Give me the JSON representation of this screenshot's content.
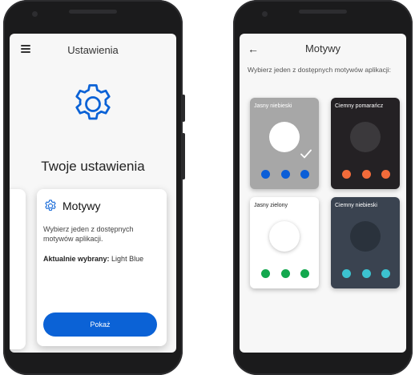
{
  "colors": {
    "primary_blue": "#0b62d6",
    "phone_body": "#1b1b1c",
    "screen_bg": "#f7f7f7"
  },
  "left_screen": {
    "menu_icon": "hamburger-menu-icon",
    "title": "Ustawienia",
    "hero_icon": "gear-icon",
    "heading": "Twoje ustawienia",
    "card": {
      "icon": "gear-icon",
      "title": "Motywy",
      "description": "Wybierz jeden z dostępnych motywów aplikacji.",
      "current_label": "Aktualnie wybrany:",
      "current_value": "Light Blue",
      "button_label": "Pokaż"
    }
  },
  "right_screen": {
    "back_icon": "arrow-left-icon",
    "title": "Motywy",
    "description": "Wybierz jeden z dostępnych motywów aplikacji:",
    "themes": [
      {
        "name": "Jasny niebieski",
        "selected": true,
        "bg": "#a7a7a7",
        "circle": "#ffffff",
        "label_color": "#ffffff",
        "dot_color": "#0b5ed7"
      },
      {
        "name": "Ciemny pomarańcz",
        "selected": false,
        "bg": "#242124",
        "circle": "#3b393c",
        "label_color": "#ffffff",
        "dot_color": "#f26b3a"
      },
      {
        "name": "Jasny zielony",
        "selected": false,
        "bg": "#ffffff",
        "circle": "#ffffff",
        "label_color": "#222222",
        "dot_color": "#13a84e"
      },
      {
        "name": "Ciemny niebieski",
        "selected": false,
        "bg": "#3a4350",
        "circle": "#2a323c",
        "label_color": "#ffffff",
        "dot_color": "#3cc3d0"
      }
    ]
  }
}
